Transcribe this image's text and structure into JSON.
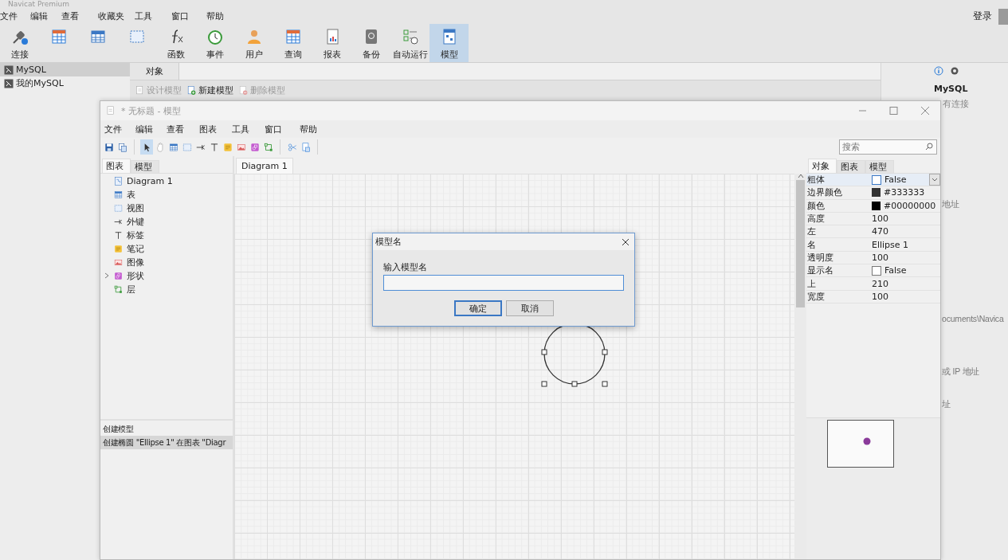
{
  "app": {
    "title": "Navicat Premium",
    "menu": [
      "文件",
      "编辑",
      "查看",
      "收藏夹",
      "工具",
      "窗口",
      "帮助"
    ],
    "login": "登录"
  },
  "toolbar": [
    {
      "kind": "connect",
      "label": "连接",
      "selected": false
    },
    {
      "kind": "query",
      "selected": false
    },
    {
      "kind": "table",
      "selected": false
    },
    {
      "kind": "view",
      "selected": false
    },
    {
      "kind": "function",
      "label": "函数",
      "selected": false
    },
    {
      "kind": "event",
      "label": "事件",
      "selected": false
    },
    {
      "kind": "user",
      "label": "用户",
      "selected": false
    },
    {
      "kind": "query",
      "label": "查询",
      "selected": false
    },
    {
      "kind": "report",
      "label": "报表",
      "selected": false
    },
    {
      "kind": "backup",
      "label": "备份",
      "selected": false
    },
    {
      "kind": "schedule",
      "label": "自动运行",
      "selected": false
    },
    {
      "kind": "model",
      "label": "模型",
      "selected": true
    }
  ],
  "connections": [
    {
      "name": "MySQL",
      "selected": true
    },
    {
      "name": "我的MySQL",
      "selected": false
    }
  ],
  "objects": {
    "tab": "对象",
    "actions": [
      {
        "kind": "design",
        "label": "设计模型",
        "disabled": true
      },
      {
        "kind": "new",
        "label": "新建模型",
        "disabled": false
      },
      {
        "kind": "delete",
        "label": "删除模型",
        "disabled": true
      }
    ]
  },
  "info": {
    "name": "MySQL",
    "status": "有连接",
    "lines": [
      "地址",
      "ocuments\\Navica",
      "或 IP 地址",
      "址"
    ]
  },
  "model_window": {
    "title": "* 无标题 - 模型",
    "menu": [
      "文件",
      "编辑",
      "查看",
      "图表",
      "工具",
      "窗口",
      "帮助"
    ],
    "tool_groups": [
      [
        {
          "kind": "save",
          "selected": false
        },
        {
          "kind": "saveas",
          "selected": false
        }
      ],
      [
        {
          "kind": "pointer",
          "selected": true
        },
        {
          "kind": "hand",
          "selected": false
        },
        {
          "kind": "table",
          "selected": false
        },
        {
          "kind": "view",
          "selected": false
        },
        {
          "kind": "fk",
          "selected": false
        },
        {
          "kind": "label",
          "selected": false
        },
        {
          "kind": "note",
          "selected": false
        },
        {
          "kind": "image",
          "selected": false
        },
        {
          "kind": "shape",
          "selected": false
        },
        {
          "kind": "layer",
          "selected": false
        }
      ],
      [
        {
          "kind": "cut",
          "selected": false
        },
        {
          "kind": "format",
          "selected": false
        }
      ]
    ],
    "search": {
      "placeholder": "搜索"
    },
    "left_tabs": [
      {
        "label": "图表",
        "selected": true
      },
      {
        "label": "模型",
        "selected": false
      }
    ],
    "tree": [
      {
        "kind": "diagram",
        "label": "Diagram 1"
      },
      {
        "kind": "table",
        "label": "表"
      },
      {
        "kind": "view",
        "label": "视图"
      },
      {
        "kind": "fk",
        "label": "外键"
      },
      {
        "kind": "label",
        "label": "标签"
      },
      {
        "kind": "note",
        "label": "笔记"
      },
      {
        "kind": "image",
        "label": "图像"
      },
      {
        "kind": "shape",
        "label": "形状",
        "expanded": false
      },
      {
        "kind": "layer",
        "label": "层"
      }
    ],
    "history": [
      {
        "text": "创建模型",
        "selected": false
      },
      {
        "text": "创建椭圆 \"Ellipse 1\" 在图表 \"Diagr",
        "selected": true
      }
    ],
    "diagram_tabs": [
      {
        "label": "Diagram 1",
        "selected": true
      }
    ],
    "right_tabs": [
      {
        "label": "对象",
        "selected": true
      },
      {
        "label": "图表",
        "selected": false
      },
      {
        "label": "模型",
        "selected": false
      }
    ],
    "properties": [
      {
        "name": "粗体",
        "kind": "checkbox",
        "checked": false,
        "value": "False",
        "selected": true
      },
      {
        "name": "边界颜色",
        "kind": "color",
        "color": "#333333",
        "value": "#333333",
        "selected": false
      },
      {
        "name": "颜色",
        "kind": "color",
        "color": "#000000",
        "value": "#00000000",
        "selected": false
      },
      {
        "name": "高度",
        "kind": "text",
        "value": "100",
        "selected": false
      },
      {
        "name": "左",
        "kind": "text",
        "value": "470",
        "selected": false
      },
      {
        "name": "名",
        "kind": "text",
        "value": "Ellipse 1",
        "selected": false
      },
      {
        "name": "透明度",
        "kind": "text",
        "value": "100",
        "selected": false
      },
      {
        "name": "显示名",
        "kind": "checkbox",
        "checked": false,
        "value": "False",
        "selected": false
      },
      {
        "name": "上",
        "kind": "text",
        "value": "210",
        "selected": false
      },
      {
        "name": "宽度",
        "kind": "text",
        "value": "100",
        "selected": false
      }
    ]
  },
  "dialog": {
    "title": "模型名",
    "label": "输入模型名",
    "buttons": [
      {
        "label": "确定",
        "default": true
      },
      {
        "label": "取消",
        "default": false
      }
    ]
  }
}
